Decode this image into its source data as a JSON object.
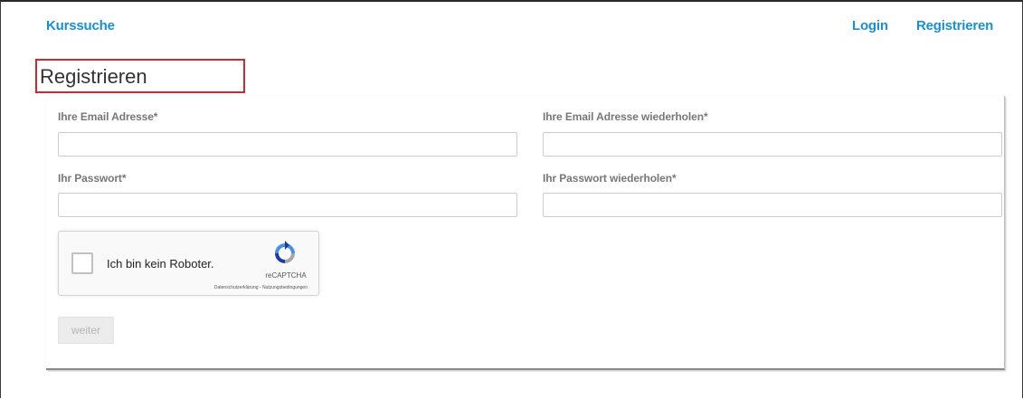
{
  "nav": {
    "brand": "Kurssuche",
    "login": "Login",
    "register": "Registrieren"
  },
  "page": {
    "title": "Registrieren"
  },
  "form": {
    "email_label": "Ihre Email Adresse*",
    "email_repeat_label": "Ihre Email Adresse wiederholen*",
    "password_label": "Ihr Passwort*",
    "password_repeat_label": "Ihr Passwort wiederholen*",
    "email_value": "",
    "email_repeat_value": "",
    "password_value": "",
    "password_repeat_value": "",
    "submit_label": "weiter"
  },
  "recaptcha": {
    "label": "Ich bin kein Roboter.",
    "brand": "reCAPTCHA",
    "terms": "Datenschutzerklärung - Nutzungsbedingungen",
    "checked": false
  },
  "colors": {
    "link": "#1a8fd1",
    "highlight_border": "#d5262e",
    "disabled_button_bg": "#ececec"
  }
}
